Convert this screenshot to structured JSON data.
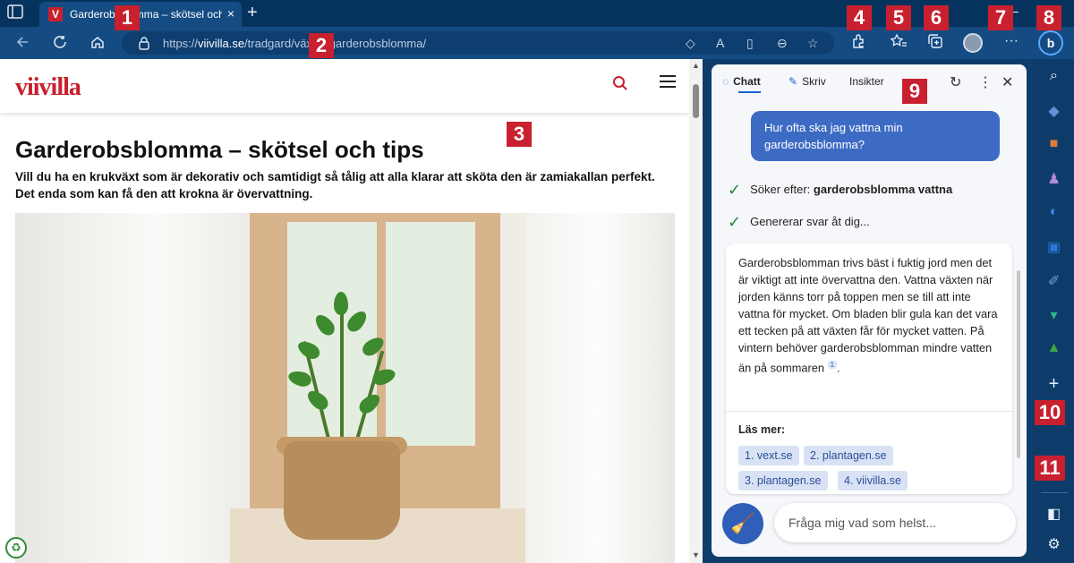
{
  "browser": {
    "tab_title": "Garderobsblomma – skötsel och tips",
    "favicon_letter": "V",
    "tab_close": "×",
    "new_tab": "+",
    "url_prefix": "https://",
    "url_domain": "viivilla.se",
    "url_path": "/tradgard/växter/garderobsblomma/",
    "more_menu": "···"
  },
  "markers": [
    "1",
    "2",
    "3",
    "4",
    "5",
    "6",
    "7",
    "8",
    "9",
    "10",
    "11"
  ],
  "page": {
    "logo": "viivilla",
    "title": "Garderobsblomma – skötsel och tips",
    "lead": "Vill du ha en krukväxt som är dekorativ och samtidigt så tålig att alla klarar att sköta den är zamiakallan perfekt. Det enda som kan få den att krokna är övervattning."
  },
  "copilot": {
    "tabs": [
      "Chatt",
      "Skriv",
      "Insikter"
    ],
    "user_message": "Hur ofta ska jag vattna min garderobsblomma?",
    "status_search_prefix": "Söker efter: ",
    "status_search_term": "garderobsblomma vattna",
    "status_generating": "Genererar svar åt dig...",
    "answer": "Garderobsblomman trivs bäst i fuktig jord men det är viktigt att inte övervattna den. Vattna växten när jorden känns torr på toppen men se till att inte vattna för mycket. Om bladen blir gula kan det vara ett tecken på att växten får för mycket vatten. På vintern behöver garderobsblomman mindre vatten än på sommaren",
    "citation": "1",
    "answer_end": ".",
    "learn_more_label": "Läs mer:",
    "sources": [
      "1. vext.se",
      "2. plantagen.se",
      "3. plantagen.se",
      "4. viivilla.se"
    ],
    "input_placeholder": "Fråga mig vad som helst..."
  },
  "colors": {
    "brand_red": "#c8202e",
    "browser_blue": "#134b82",
    "bubble_blue": "#3d6bc4",
    "check_green": "#2c8a3d"
  }
}
